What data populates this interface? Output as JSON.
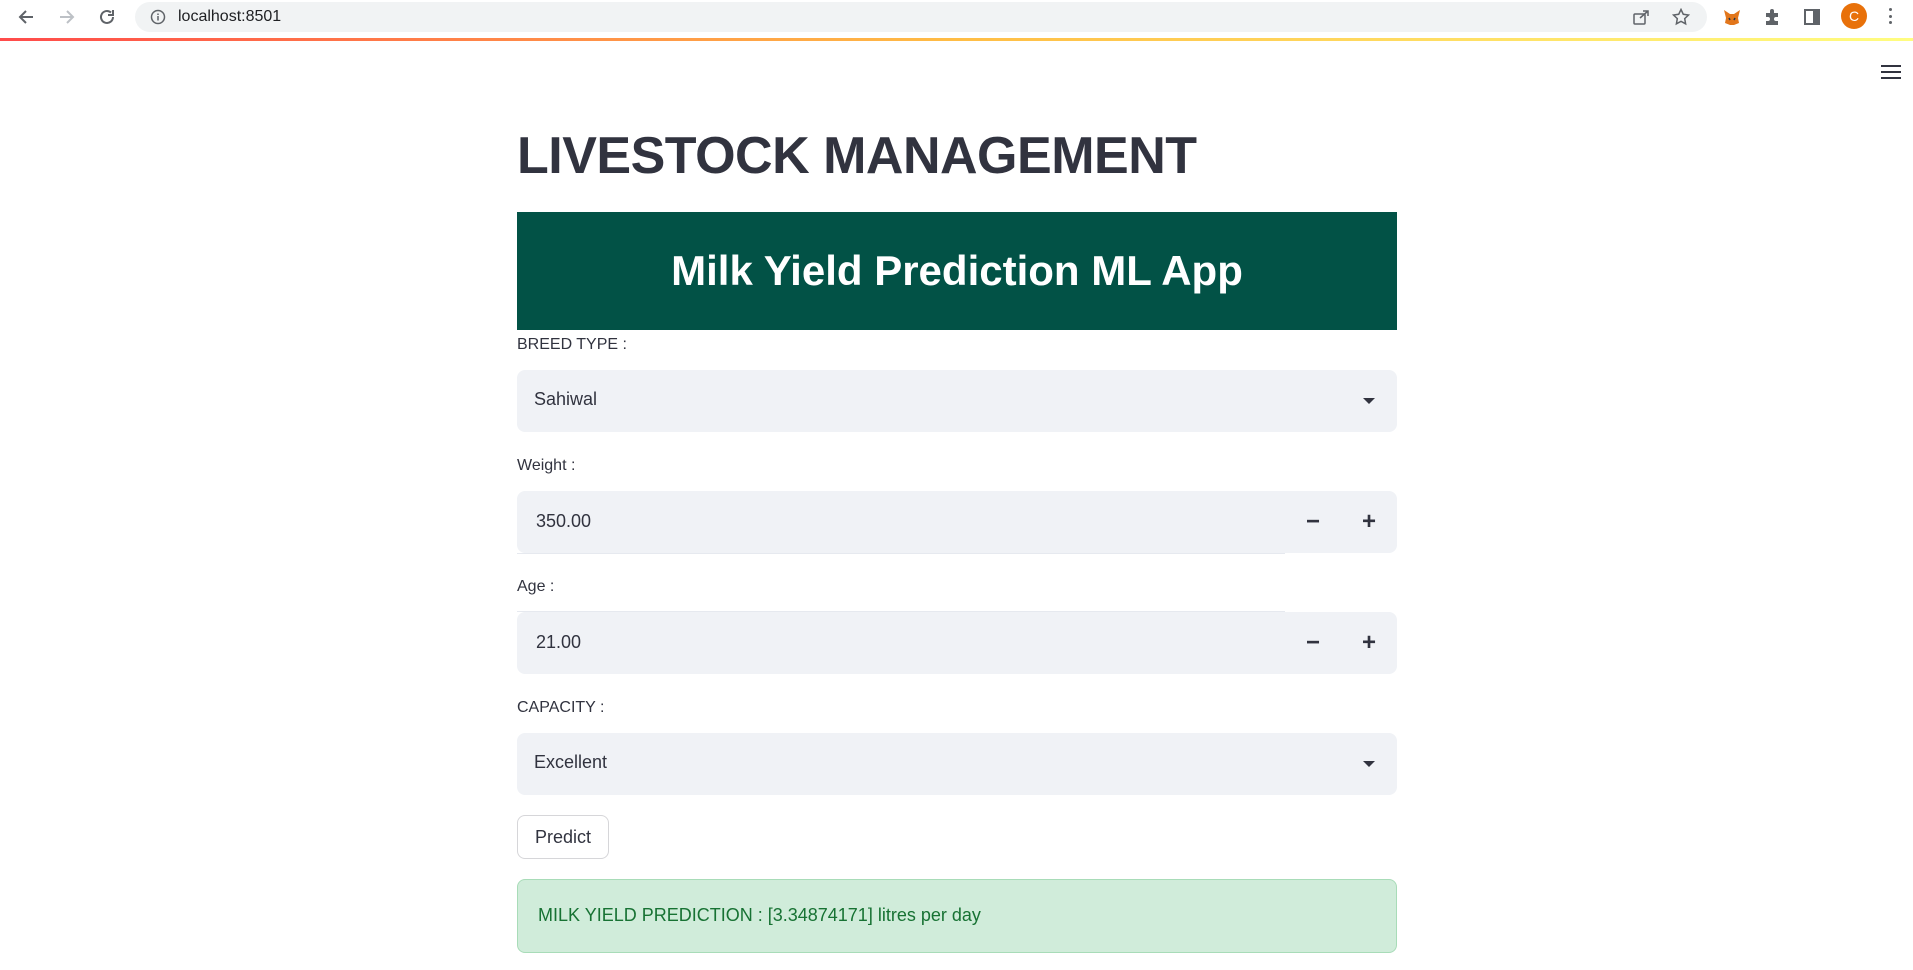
{
  "browser": {
    "url": "localhost:8501",
    "profile_initial": "C",
    "profile_color": "#e8710a"
  },
  "app": {
    "title": "LIVESTOCK MANAGEMENT",
    "banner_title": "Milk Yield Prediction ML App",
    "banner_color": "#025246",
    "decoration_colors": [
      "#ff4b4b",
      "#ffbd45",
      "#fffd80"
    ]
  },
  "form": {
    "breed": {
      "label": "BREED TYPE :",
      "value": "Sahiwal"
    },
    "weight": {
      "label": "Weight :",
      "value": "350.00",
      "minus": "−",
      "plus": "+"
    },
    "age": {
      "label": "Age :",
      "value": "21.00",
      "minus": "−",
      "plus": "+"
    },
    "capacity": {
      "label": "CAPACITY :",
      "value": "Excellent"
    },
    "predict_label": "Predict"
  },
  "result": {
    "message": "MILK YIELD PREDICTION : [3.34874171] litres per day",
    "color": "#177233",
    "background": "#d0ecda"
  }
}
